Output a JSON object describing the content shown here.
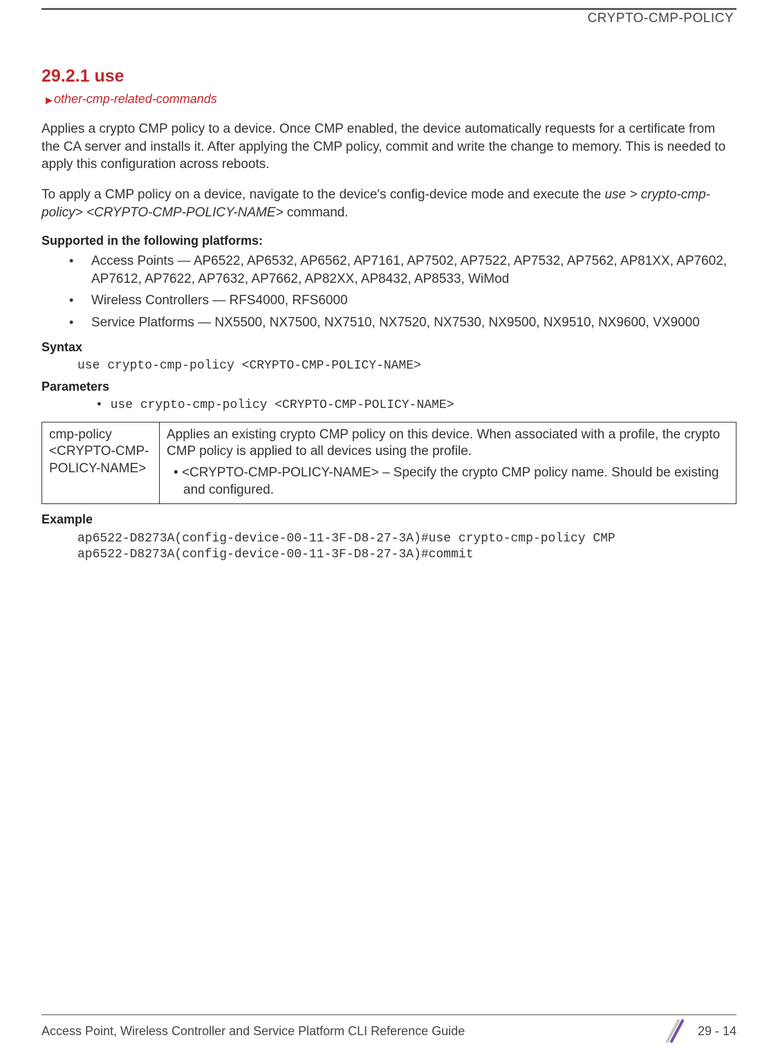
{
  "header": {
    "title": "CRYPTO-CMP-POLICY"
  },
  "section": {
    "number_title": "29.2.1 use",
    "breadcrumb": "other-cmp-related-commands"
  },
  "body": {
    "intro1": "Applies a crypto CMP policy to a device. Once CMP enabled, the device automatically requests for a certificate from the CA server and installs it. After applying the CMP policy, commit and write the change to memory. This is needed to apply this configuration across reboots.",
    "intro2_a": "To apply a CMP policy on a device, navigate to the device's config-device mode and execute the ",
    "intro2_b": "use > crypto-cmp-policy> <CRYPTO-CMP-POLICY-NAME>",
    "intro2_c": " command.",
    "supported_heading": "Supported in the following platforms:",
    "platforms": [
      "Access Points — AP6522, AP6532, AP6562, AP7161, AP7502, AP7522, AP7532, AP7562, AP81XX, AP7602, AP7612, AP7622, AP7632, AP7662, AP82XX, AP8432, AP8533, WiMod",
      "Wireless Controllers — RFS4000, RFS6000",
      "Service Platforms — NX5500, NX7500, NX7510, NX7520, NX7530, NX9500, NX9510, NX9600, VX9000"
    ],
    "syntax_heading": "Syntax",
    "syntax_text": "use crypto-cmp-policy <CRYPTO-CMP-POLICY-NAME>",
    "parameters_heading": "Parameters",
    "parameters_bullet": "use crypto-cmp-policy <CRYPTO-CMP-POLICY-NAME>",
    "param_table": {
      "col1": "cmp-policy <CRYPTO-CMP-POLICY-NAME>",
      "col2_a": "Applies an existing crypto CMP policy on this device. When associated with a profile, the crypto CMP policy is applied to all devices using the profile.",
      "col2_b": "<CRYPTO-CMP-POLICY-NAME> – Specify the crypto CMP policy name. Should be existing and configured."
    },
    "example_heading": "Example",
    "example_text": "ap6522-D8273A(config-device-00-11-3F-D8-27-3A)#use crypto-cmp-policy CMP\nap6522-D8273A(config-device-00-11-3F-D8-27-3A)#commit"
  },
  "footer": {
    "guide": "Access Point, Wireless Controller and Service Platform CLI Reference Guide",
    "page": "29 - 14"
  }
}
